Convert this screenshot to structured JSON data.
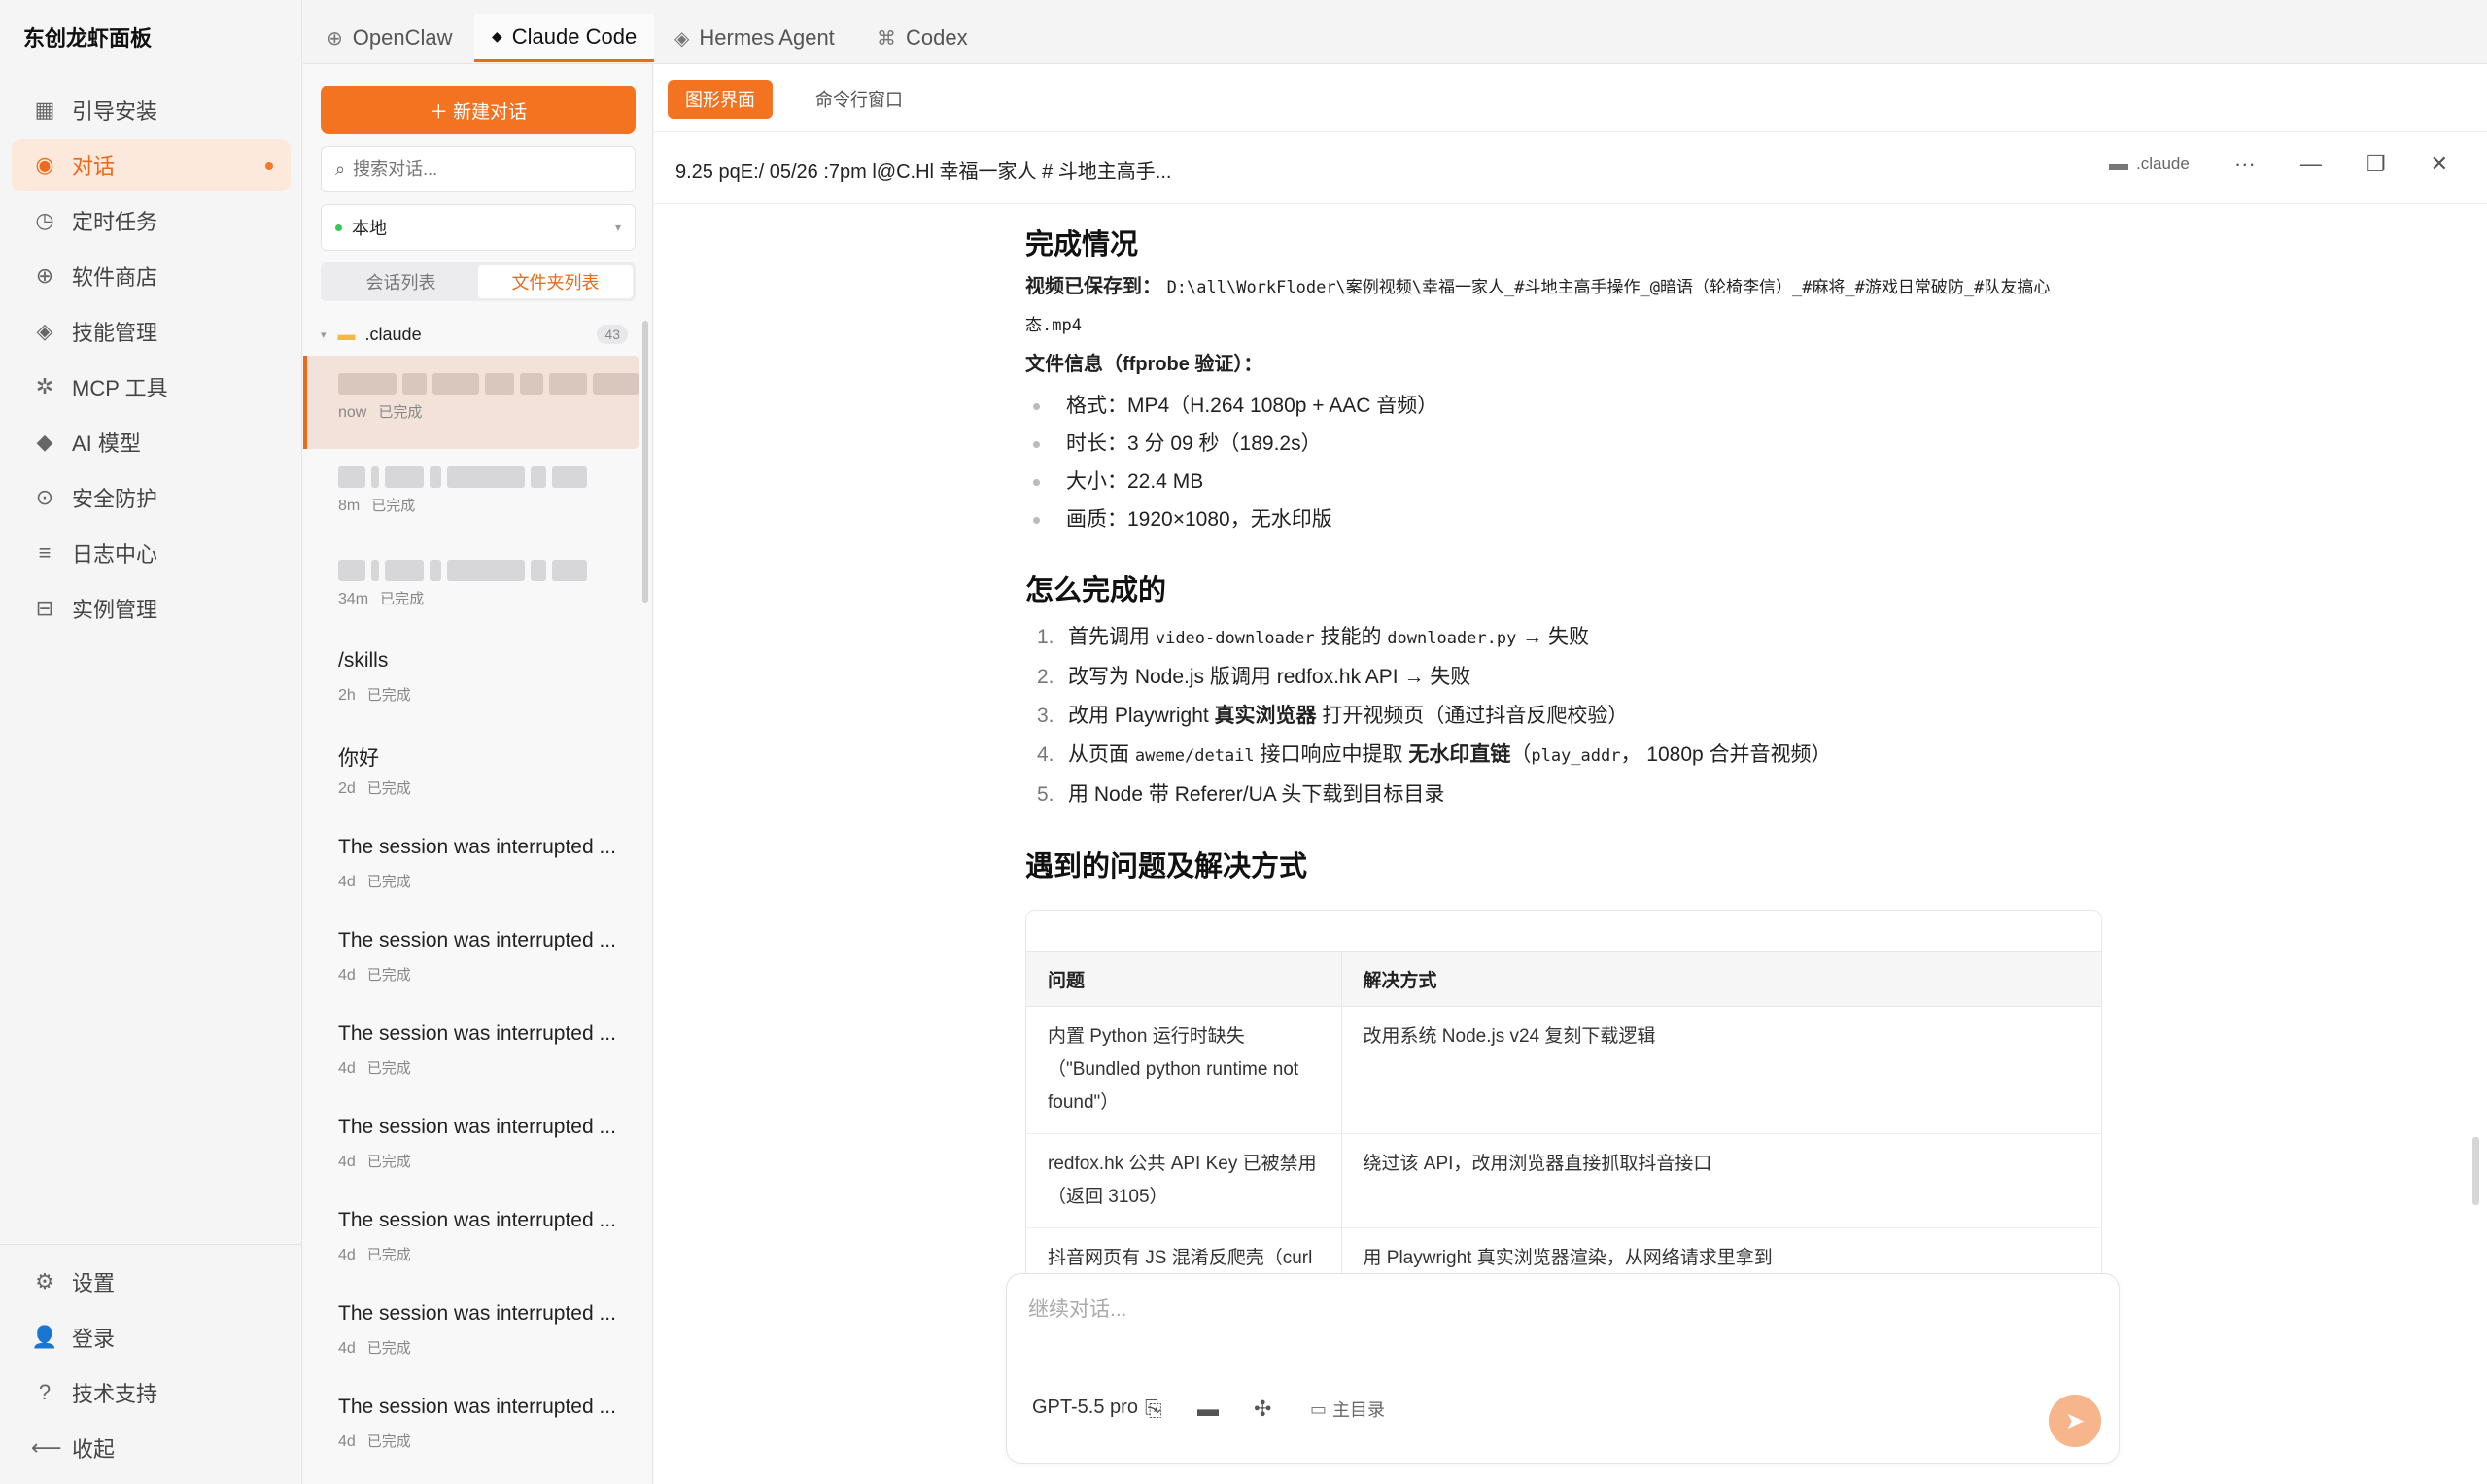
{
  "app": {
    "title": "东创龙虾面板"
  },
  "nav": {
    "items": [
      {
        "icon": "▦",
        "icon_name": "grid-icon",
        "label": "引导安装"
      },
      {
        "icon": "◉",
        "icon_name": "chat-icon",
        "label": "对话",
        "active": true
      },
      {
        "icon": "◷",
        "icon_name": "clock-icon",
        "label": "定时任务"
      },
      {
        "icon": "⊕",
        "icon_name": "store-icon",
        "label": "软件商店"
      },
      {
        "icon": "◈",
        "icon_name": "skill-icon",
        "label": "技能管理"
      },
      {
        "icon": "✲",
        "icon_name": "gear-icon",
        "label": "MCP 工具"
      },
      {
        "icon": "◆",
        "icon_name": "ai-icon",
        "label": "AI 模型"
      },
      {
        "icon": "⊙",
        "icon_name": "shield-icon",
        "label": "安全防护"
      },
      {
        "icon": "≡",
        "icon_name": "log-icon",
        "label": "日志中心"
      },
      {
        "icon": "⊟",
        "icon_name": "instance-icon",
        "label": "实例管理"
      }
    ],
    "bottom": [
      {
        "icon": "⚙",
        "icon_name": "settings-icon",
        "label": "设置"
      },
      {
        "icon": "👤",
        "icon_name": "user-icon",
        "label": "登录"
      },
      {
        "icon": "?",
        "icon_name": "help-icon",
        "label": "技术支持"
      },
      {
        "icon": "⟵",
        "icon_name": "collapse-icon",
        "label": "收起"
      }
    ]
  },
  "tabs": [
    {
      "icon": "⊕",
      "label": "OpenClaw"
    },
    {
      "icon": "◆",
      "label": "Claude Code",
      "active": true
    },
    {
      "icon": "◈",
      "label": "Hermes Agent"
    },
    {
      "icon": "⌘",
      "label": "Codex"
    }
  ],
  "sessions": {
    "new_label": "＋  新建对话",
    "search_placeholder": "搜索对话...",
    "location": "本地",
    "segments": [
      "会话列表",
      "文件夹列表"
    ],
    "folder": {
      "name": ".claude",
      "count": "43"
    },
    "items": [
      {
        "title": "",
        "blurred": true,
        "time": "now",
        "status": "已完成",
        "selected": true
      },
      {
        "title": "",
        "blurred": true,
        "time": "8m",
        "status": "已完成"
      },
      {
        "title": "",
        "blurred": true,
        "time": "34m",
        "status": "已完成"
      },
      {
        "title": "/skills",
        "time": "2h",
        "status": "已完成"
      },
      {
        "title": "你好",
        "time": "2d",
        "status": "已完成"
      },
      {
        "title": "The session was interrupted ...",
        "time": "4d",
        "status": "已完成"
      },
      {
        "title": "The session was interrupted ...",
        "time": "4d",
        "status": "已完成"
      },
      {
        "title": "The session was interrupted ...",
        "time": "4d",
        "status": "已完成"
      },
      {
        "title": "The session was interrupted ...",
        "time": "4d",
        "status": "已完成"
      },
      {
        "title": "The session was interrupted ...",
        "time": "4d",
        "status": "已完成"
      },
      {
        "title": "The session was interrupted ...",
        "time": "4d",
        "status": "已完成"
      },
      {
        "title": "The session was interrupted ...",
        "time": "4d",
        "status": "已完成"
      }
    ]
  },
  "main": {
    "subtabs": [
      "图形界面",
      "命令行窗口"
    ],
    "title": "9.25 pqE:/ 05/26 :7pm l@C.Hl 幸福一家人 # 斗地主高手...",
    "folder_label": ".claude",
    "header_icons": {
      "more": "···",
      "minimize": "—",
      "restore": "❐",
      "close": "✕"
    }
  },
  "doc": {
    "h_complete": "完成情况",
    "saved_label": "视频已保存到：",
    "saved_path": "D:\\all\\WorkFloder\\案例视频\\幸福一家人_#斗地主高手操作_@暗语（轮椅李信）_#麻将_#游戏日常破防_#队友搞心态.mp4",
    "fileinfo_label": "文件信息（ffprobe 验证）：",
    "fileinfo": [
      "格式：MP4（H.264 1080p + AAC 音频）",
      "时长：3 分 09 秒（189.2s）",
      "大小：22.4 MB",
      "画质：1920×1080，无水印版"
    ],
    "h_how": "怎么完成的",
    "steps": [
      {
        "n": "1.",
        "a": "首先调用 ",
        "code1": "video-downloader",
        "b": " 技能的 ",
        "code2": "downloader.py",
        "c": " → 失败"
      },
      {
        "n": "2.",
        "a": "改写为 Node.js 版调用 redfox.hk API → 失败"
      },
      {
        "n": "3.",
        "a": "改用 Playwright ",
        "bold": "真实浏览器",
        "b": " 打开视频页（通过抖音反爬校验）"
      },
      {
        "n": "4.",
        "a": "从页面 ",
        "code1": "aweme/detail",
        "b": " 接口响应中提取 ",
        "bold": "无水印直链",
        "c": "（",
        "code2": "play_addr",
        "d": "， 1080p 合并音视频）"
      },
      {
        "n": "5.",
        "a": "用 Node 带 Referer/UA 头下载到目标目录"
      }
    ],
    "h_issues": "遇到的问题及解决方式",
    "table": {
      "headers": [
        "问题",
        "解决方式"
      ],
      "rows": [
        [
          "内置 Python 运行时缺失（\"Bundled python runtime not found\"）",
          "改用系统 Node.js v24 复刻下载逻辑"
        ],
        [
          "redfox.hk 公共 API Key 已被禁用（返回 3105）",
          "绕过该 API，改用浏览器直接抓取抖音接口"
        ],
        [
          "抖音网页有 JS 混淆反爬壳（curl 拿不到视频地址）",
          "用 Playwright 真实浏览器渲染，从网络请求里拿到 |aweme/detail| JSON"
        ]
      ]
    }
  },
  "composer": {
    "placeholder": "继续对话...",
    "model": "GPT-5.5 pro",
    "dir_label": "主目录"
  },
  "colors": {
    "accent": "#f37321",
    "accent_light": "#fde8dc"
  }
}
